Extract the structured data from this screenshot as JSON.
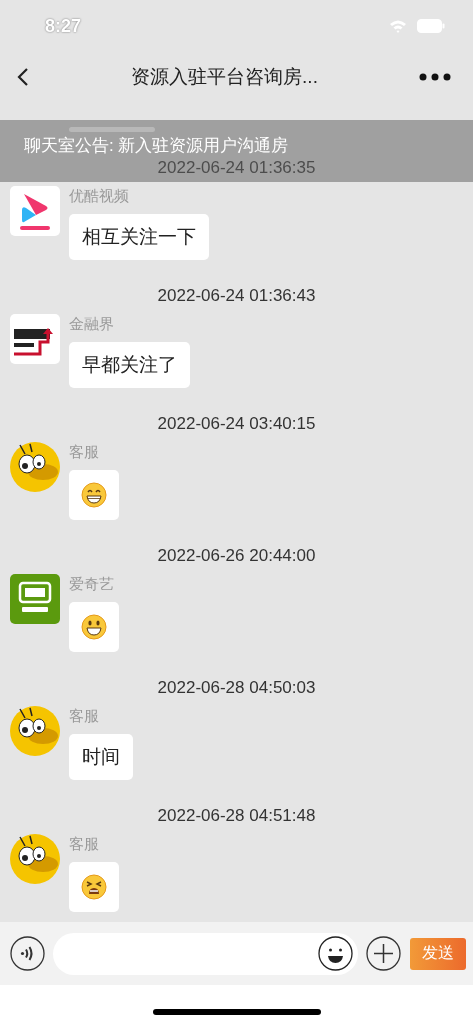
{
  "status_bar": {
    "time": "8:27"
  },
  "nav": {
    "title": "资源入驻平台咨询房..."
  },
  "announcement": {
    "text": "聊天室公告: 新入驻资源用户沟通房"
  },
  "messages": [
    {
      "time": "2022-06-24 01:36:35",
      "sender": "优酷视频",
      "avatar": {
        "kind": "play"
      },
      "kind": "text",
      "text": "相互关注一下"
    },
    {
      "time": "2022-06-24 01:36:43",
      "sender": "金融界",
      "avatar": {
        "kind": "arrow"
      },
      "kind": "text",
      "text": "早都关注了"
    },
    {
      "time": "2022-06-24 03:40:15",
      "sender": "客服",
      "avatar": {
        "kind": "bug"
      },
      "kind": "emoji",
      "emoji": {
        "kind": "grin"
      }
    },
    {
      "time": "2022-06-26 20:44:00",
      "sender": "爱奇艺",
      "avatar": {
        "kind": "tile"
      },
      "kind": "emoji",
      "emoji": {
        "kind": "smile"
      }
    },
    {
      "time": "2022-06-28 04:50:03",
      "sender": "客服",
      "avatar": {
        "kind": "bug"
      },
      "kind": "text",
      "text": "时间"
    },
    {
      "time": "2022-06-28 04:51:48",
      "sender": "客服",
      "avatar": {
        "kind": "bug"
      },
      "kind": "emoji",
      "emoji": {
        "kind": "tired"
      }
    }
  ],
  "composer": {
    "send_label": "发送"
  }
}
